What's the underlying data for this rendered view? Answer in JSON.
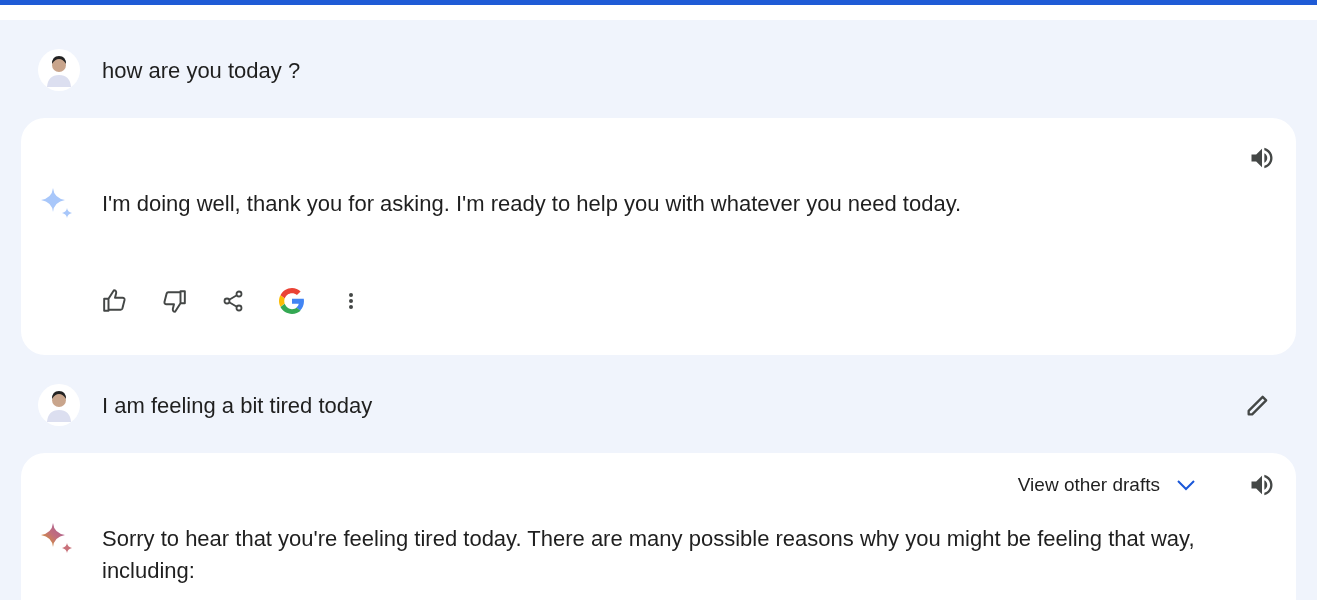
{
  "messages": [
    {
      "kind": "user",
      "text": "how are you today ?",
      "editable": false
    },
    {
      "kind": "model",
      "text": "I'm doing well, thank you for asking. I'm ready to help you with whatever you need today.",
      "sparkle_active": false,
      "actions": true
    },
    {
      "kind": "user",
      "text": "I am feeling a bit tired today",
      "editable": true
    },
    {
      "kind": "model",
      "text": "Sorry to hear that you're feeling tired today. There are many possible reasons why you might be feeling that way, including:",
      "sparkle_active": true,
      "drafts_label": "View other drafts"
    }
  ]
}
